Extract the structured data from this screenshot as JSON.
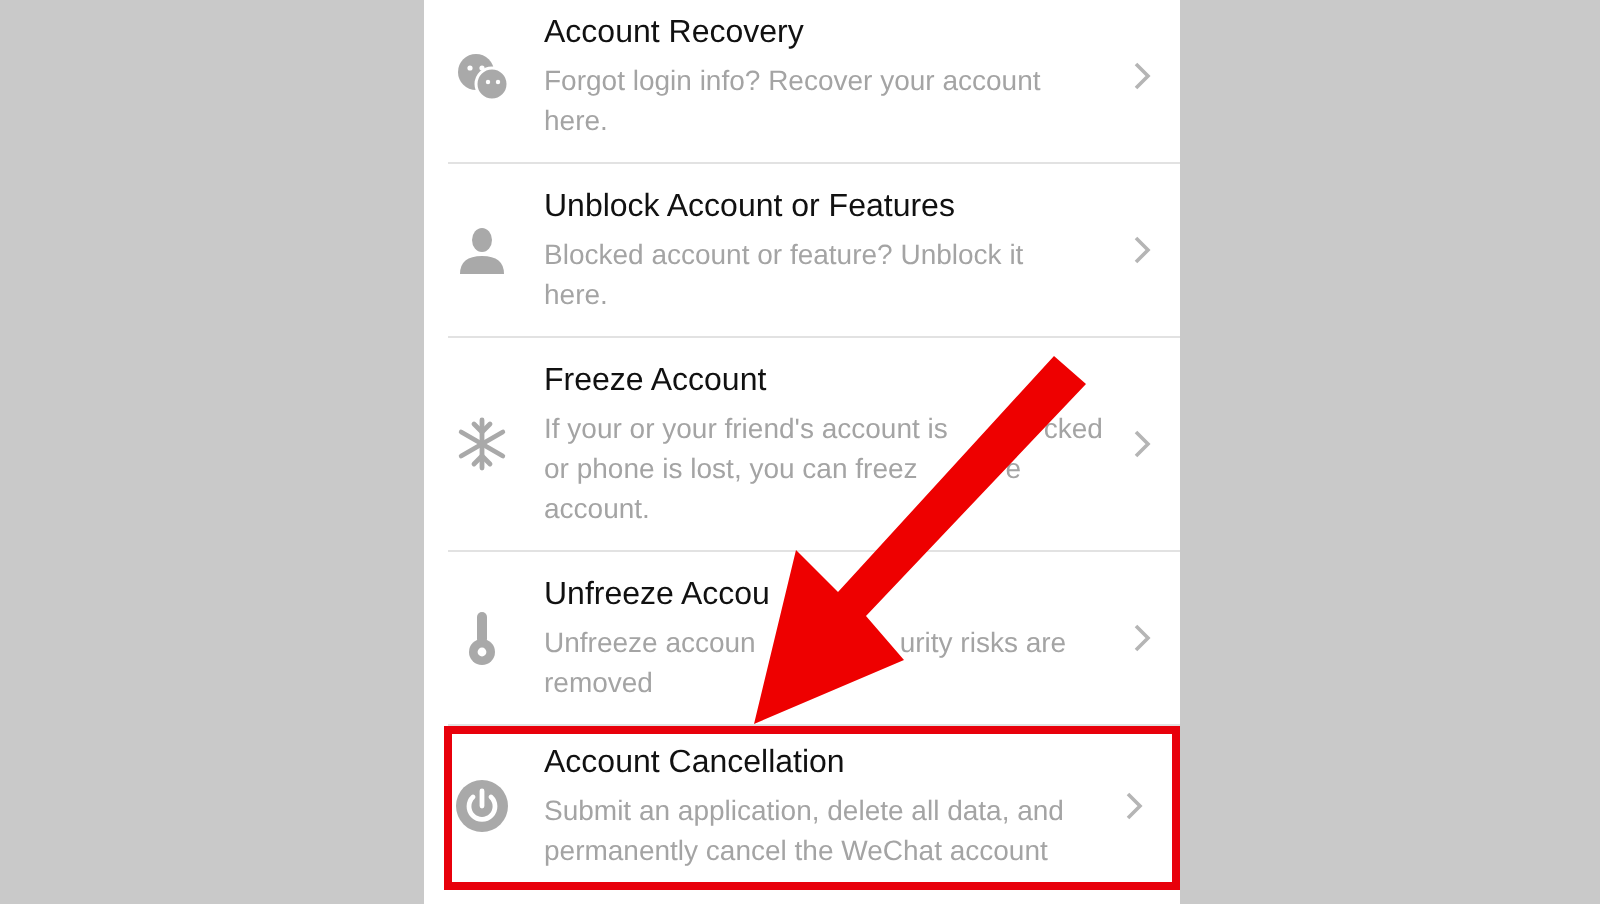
{
  "items": [
    {
      "title": "Account Recovery",
      "description_lines": [
        [
          "Forgot login info? Recover your account"
        ],
        [
          "here."
        ]
      ],
      "highlighted": false
    },
    {
      "title": "Unblock Account or Features",
      "description_lines": [
        [
          "Blocked account or feature? Unblock it"
        ],
        [
          "here."
        ]
      ],
      "highlighted": false
    },
    {
      "title": "Freeze Account",
      "description_lines": [
        [
          "If your or your friend's account is",
          "cked"
        ],
        [
          "or phone is lost, you can freez",
          "e"
        ],
        [
          "account."
        ]
      ],
      "highlighted": false
    },
    {
      "title": "Unfreeze Accou",
      "description_lines": [
        [
          "Unfreeze accoun",
          "urity risks are"
        ],
        [
          "removed"
        ]
      ],
      "highlighted": false
    },
    {
      "title": "Account Cancellation",
      "description_lines": [
        [
          "Submit an application, delete all data, and"
        ],
        [
          "permanently cancel the WeChat account"
        ]
      ],
      "highlighted": true
    }
  ]
}
